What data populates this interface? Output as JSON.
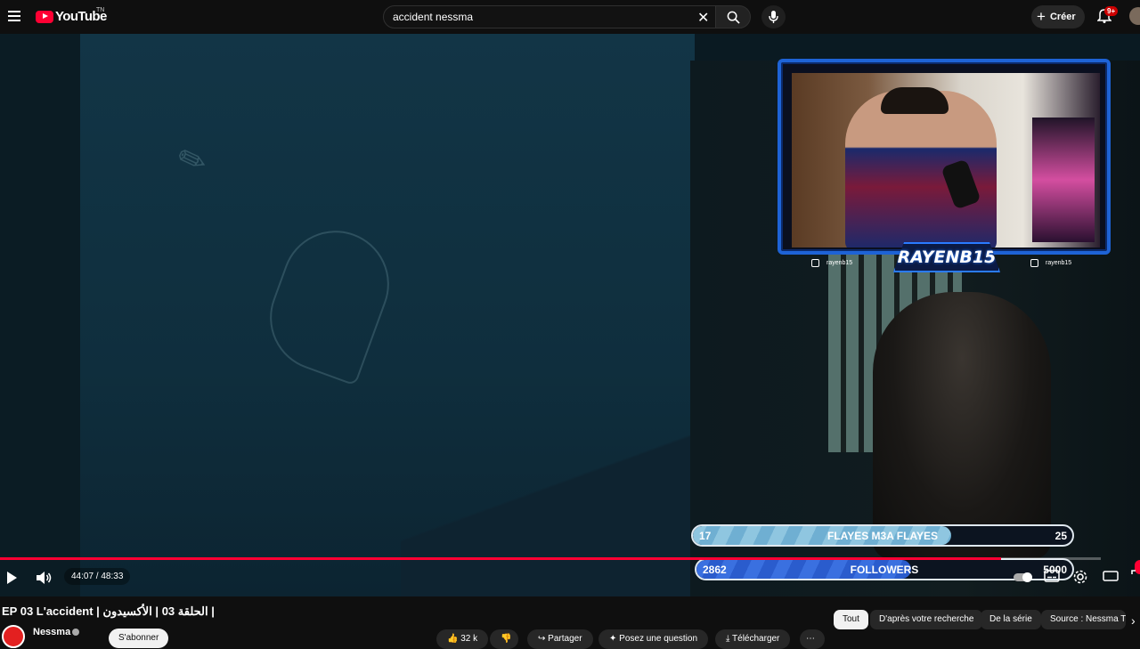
{
  "topbar": {
    "logo_text": "YouTube",
    "logo_region": "TN",
    "search_value": "accident nessma",
    "create_label": "Créer",
    "notif_badge": "9+"
  },
  "overlay": {
    "streamer_name": "RAYENB15",
    "instagram_handle": "rayenb15",
    "youtube_handle": "rayenb15",
    "goal": {
      "current": "17",
      "title": "FLAYES M3A FLAYES",
      "target": "25",
      "fraction": 0.68
    },
    "followers": {
      "current": "2862",
      "title": "FOLLOWERS",
      "target": "5000",
      "fraction": 0.57
    }
  },
  "player": {
    "time": "44:07 / 48:33",
    "progress_fraction": 0.909
  },
  "video": {
    "title": "EP 03 L'accident | الحلقة 03 | الأكسيدون |",
    "channel": "Nessma",
    "subscribe_label": "S'abonner",
    "likes": "32 k",
    "share_label": "Partager",
    "ask_label": "Posez une question",
    "download_label": "Télécharger"
  },
  "chips": [
    "Tout",
    "D'après votre recherche",
    "De la série",
    "Source : Nessma T"
  ],
  "colors": {
    "brand_red": "#ff0033",
    "overlay_blue": "#1e63d6"
  }
}
